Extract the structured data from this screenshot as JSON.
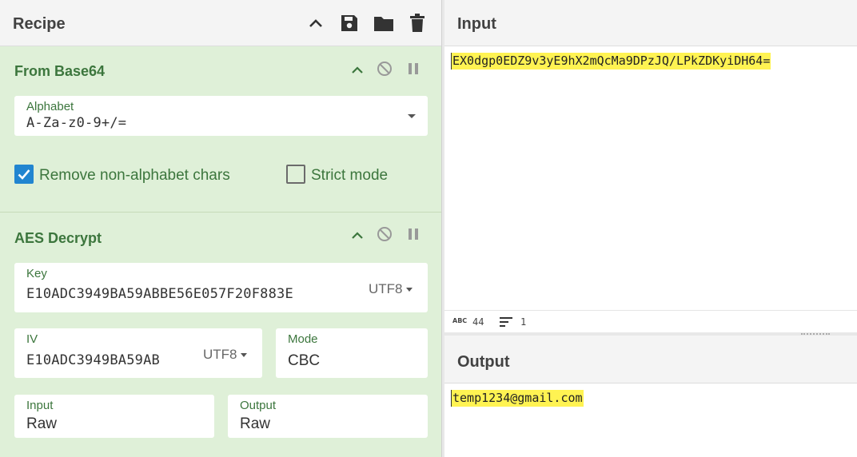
{
  "recipe": {
    "title": "Recipe",
    "toolbar_icons": [
      "chevron-up-icon",
      "save-icon",
      "folder-icon",
      "trash-icon"
    ],
    "operations": [
      {
        "title": "From Base64",
        "alphabet": {
          "label": "Alphabet",
          "value": "A-Za-z0-9+/="
        },
        "remove_non_alphabet": {
          "label": "Remove non-alphabet chars",
          "checked": true
        },
        "strict_mode": {
          "label": "Strict mode",
          "checked": false
        }
      },
      {
        "title": "AES Decrypt",
        "key": {
          "label": "Key",
          "value": "E10ADC3949BA59ABBE56E057F20F883E",
          "encoding": "UTF8"
        },
        "iv": {
          "label": "IV",
          "value": "E10ADC3949BA59AB",
          "encoding": "UTF8"
        },
        "mode": {
          "label": "Mode",
          "value": "CBC"
        },
        "input": {
          "label": "Input",
          "value": "Raw"
        },
        "output": {
          "label": "Output",
          "value": "Raw"
        }
      }
    ]
  },
  "input": {
    "title": "Input",
    "text": "EX0dgp0EDZ9v3yE9hX2mQcMa9DPzJQ/LPkZDKyiDH64=",
    "stats": {
      "chars": "44",
      "lines": "1"
    }
  },
  "output": {
    "title": "Output",
    "text": "temp1234@gmail.com"
  },
  "colors": {
    "operation_bg": "#dff0d8",
    "operation_text": "#3c763d",
    "highlight": "#fff352",
    "checkbox_accent": "#2185d0"
  }
}
